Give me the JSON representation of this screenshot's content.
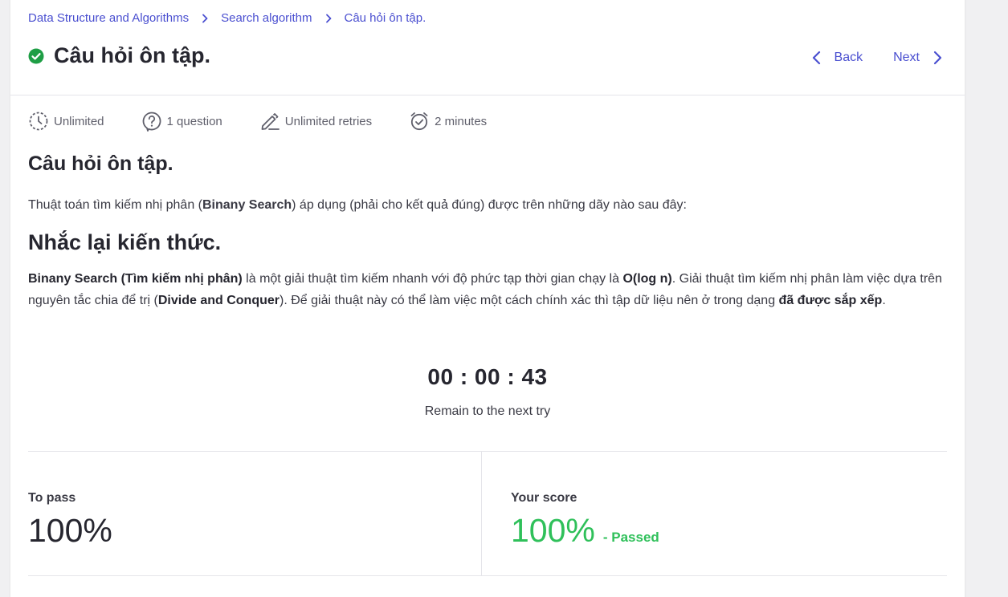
{
  "breadcrumb": {
    "items": [
      "Data Structure and Algorithms",
      "Search algorithm",
      "Câu hỏi ôn tập."
    ]
  },
  "header": {
    "title": "Câu hỏi ôn tập.",
    "status_icon": "check-circle-icon",
    "back_label": "Back",
    "next_label": "Next"
  },
  "meta": {
    "time_limit": "Unlimited",
    "questions": "1 question",
    "retries": "Unlimited retries",
    "duration": "2 minutes"
  },
  "content": {
    "heading": "Câu hỏi ôn tập.",
    "question_parts": [
      "Thuật toán tìm kiếm nhị phân (",
      "Binany Search",
      ") áp dụng (phải cho kết quả đúng) được trên những dãy nào sau đây:"
    ],
    "review_heading": "Nhắc lại kiến thức.",
    "explain_parts": [
      "Binany Search (Tìm kiếm nhị phân)",
      " là một giải thuật tìm kiếm nhanh với độ phức tạp thời gian chạy là ",
      "O(log n)",
      ". Giải thuật tìm kiếm nhị phân làm việc dựa trên nguyên tắc chia để trị (",
      "Divide and Conquer",
      "). Để giải thuật này có thể làm việc một cách chính xác thì tập dữ liệu nên ở trong dạng ",
      "đã được sắp xếp",
      "."
    ]
  },
  "timer": {
    "value": "00 : 00 : 43",
    "caption": "Remain to the next try"
  },
  "score": {
    "to_pass_label": "To pass",
    "to_pass_value": "100%",
    "your_score_label": "Your score",
    "your_score_value": "100%",
    "status": "- Passed"
  },
  "colors": {
    "accent": "#4a4fd0",
    "success": "#2fc05a",
    "check_icon": "#1e9e45"
  }
}
